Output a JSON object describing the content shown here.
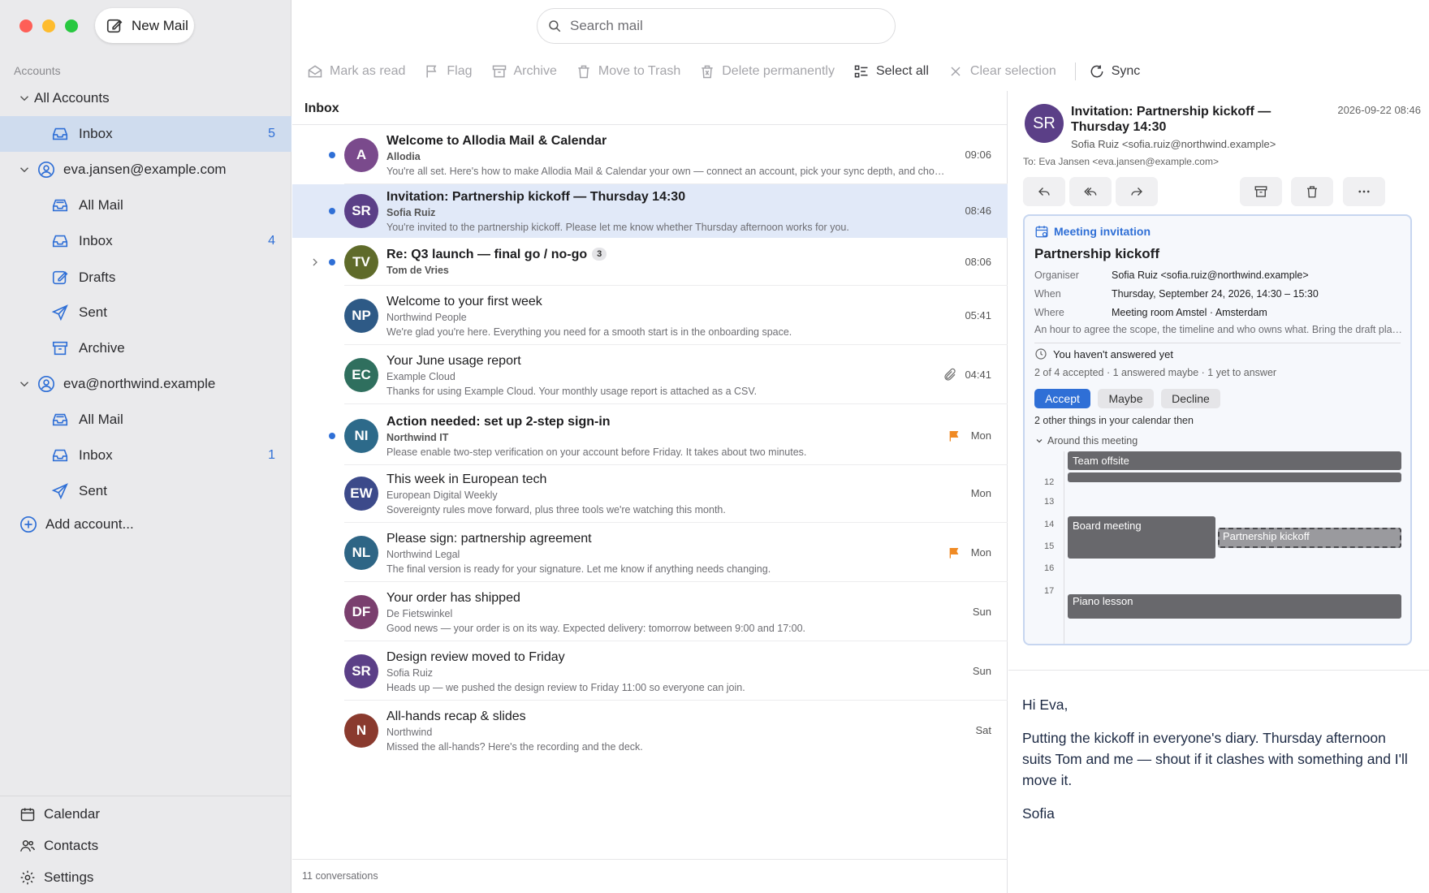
{
  "window": {
    "controls": [
      "close",
      "minimize",
      "maximize"
    ]
  },
  "toolbar": {
    "new_mail": "New Mail",
    "search_placeholder": "Search mail",
    "actions": [
      "Mark as read",
      "Flag",
      "Archive",
      "Move to Trash",
      "Delete permanently",
      "Select all",
      "Clear selection",
      "Sync"
    ]
  },
  "sidebar": {
    "section": "Accounts",
    "all_accounts": {
      "label": "All Accounts",
      "inbox": {
        "label": "Inbox",
        "count": "5"
      }
    },
    "accounts": [
      {
        "email": "eva.jansen@example.com",
        "folders": [
          {
            "label": "All Mail",
            "count": ""
          },
          {
            "label": "Inbox",
            "count": "4"
          },
          {
            "label": "Drafts",
            "count": ""
          },
          {
            "label": "Sent",
            "count": ""
          },
          {
            "label": "Archive",
            "count": ""
          }
        ]
      },
      {
        "email": "eva@northwind.example",
        "folders": [
          {
            "label": "All Mail",
            "count": ""
          },
          {
            "label": "Inbox",
            "count": "1"
          },
          {
            "label": "Sent",
            "count": ""
          }
        ]
      }
    ],
    "add_account": "Add account...",
    "bottom": [
      "Calendar",
      "Contacts",
      "Settings"
    ]
  },
  "list": {
    "title": "Inbox",
    "footer": "11 conversations",
    "messages": [
      {
        "initials": "A",
        "color": "#7a4a8c",
        "subject": "Welcome to Allodia Mail & Calendar",
        "from": "Allodia",
        "preview": "You're all set. Here's how to make Allodia Mail & Calendar your own — connect an account, pick your sync depth, and choose how you want to be notified.",
        "time": "09:06",
        "unread": true
      },
      {
        "initials": "SR",
        "color": "#5b3f87",
        "subject": "Invitation: Partnership kickoff — Thursday 14:30",
        "from": "Sofia Ruiz",
        "preview": "You're invited to the partnership kickoff. Please let me know whether Thursday afternoon works for you.",
        "time": "08:46",
        "unread": true
      },
      {
        "initials": "TV",
        "color": "#5f6b2a",
        "subject": "Re: Q3 launch — final go / no-go",
        "from": "Tom de Vries",
        "preview": "",
        "time": "08:06",
        "unread": true,
        "count": "3"
      },
      {
        "initials": "NP",
        "color": "#2e5a86",
        "subject": "Welcome to your first week",
        "from": "Northwind People",
        "preview": "We're glad you're here. Everything you need for a smooth start is in the onboarding space.",
        "time": "05:41",
        "unread": false
      },
      {
        "initials": "EC",
        "color": "#2f6f5e",
        "subject": "Your June usage report",
        "from": "Example Cloud",
        "preview": "Thanks for using Example Cloud. Your monthly usage report is attached as a CSV.",
        "time": "04:41",
        "unread": false
      },
      {
        "initials": "NI",
        "color": "#2d6a8a",
        "subject": "Action needed: set up 2-step sign-in",
        "from": "Northwind IT",
        "preview": "Please enable two-step verification on your account before Friday. It takes about two minutes.",
        "time": "Mon",
        "unread": true
      },
      {
        "initials": "EW",
        "color": "#3c4a8a",
        "subject": "This week in European tech",
        "from": "European Digital Weekly",
        "preview": "Sovereignty rules move forward, plus three tools we're watching this month.",
        "time": "Mon",
        "unread": false
      },
      {
        "initials": "NL",
        "color": "#2e6585",
        "subject": "Please sign: partnership agreement",
        "from": "Northwind Legal",
        "preview": "The final version is ready for your signature. Let me know if anything needs changing.",
        "time": "Mon",
        "unread": false
      },
      {
        "initials": "DF",
        "color": "#7a3f6e",
        "subject": "Your order has shipped",
        "from": "De Fietswinkel",
        "preview": "Good news — your order is on its way. Expected delivery: tomorrow between 9:00 and 17:00.",
        "time": "Sun",
        "unread": false
      },
      {
        "initials": "SR",
        "color": "#5b3f87",
        "subject": "Design review moved to Friday",
        "from": "Sofia Ruiz",
        "preview": "Heads up — we pushed the design review to Friday 11:00 so everyone can join.",
        "time": "Sun",
        "unread": false
      },
      {
        "initials": "N",
        "color": "#8a3a2e",
        "subject": "All-hands recap & slides",
        "from": "Northwind",
        "preview": "Missed the all-hands? Here's the recording and the deck.",
        "time": "Sat",
        "unread": false
      }
    ]
  },
  "reading": {
    "avatar": "SR",
    "subject": "Invitation: Partnership kickoff — Thursday 14:30",
    "date": "2026-09-22 08:46",
    "from": "Sofia Ruiz <sofia.ruiz@northwind.example>",
    "to": "To: Eva Jansen <eva.jansen@example.com>",
    "invite": {
      "header": "Meeting invitation",
      "title": "Partnership kickoff",
      "organiser_label": "Organiser",
      "organiser": "Sofia Ruiz <sofia.ruiz@northwind.example>",
      "when_label": "When",
      "when": "Thursday, September 24, 2026, 14:30 – 15:30",
      "where_label": "Where",
      "where": "Meeting room Amstel · Amsterdam",
      "description": "An hour to agree the scope, the timeline and who owns what. Bring the draft plan and your questions.",
      "status": "You haven't answered yet",
      "counts": "2 of 4 accepted · 1 answered maybe · 1 yet to answer",
      "accept": "Accept",
      "maybe": "Maybe",
      "decline": "Decline",
      "other": "2 other things in your calendar then",
      "around": "Around this meeting",
      "hours": [
        "12",
        "13",
        "14",
        "15",
        "16",
        "17"
      ],
      "events": {
        "offsite": "Team offsite",
        "board": "Board meeting",
        "kickoff": "Partnership kickoff",
        "piano": "Piano lesson"
      }
    },
    "body": [
      "Hi Eva,",
      "Putting the kickoff in everyone's diary. Thursday afternoon suits Tom and me — shout if it clashes with something and I'll move it.",
      "Sofia"
    ]
  }
}
